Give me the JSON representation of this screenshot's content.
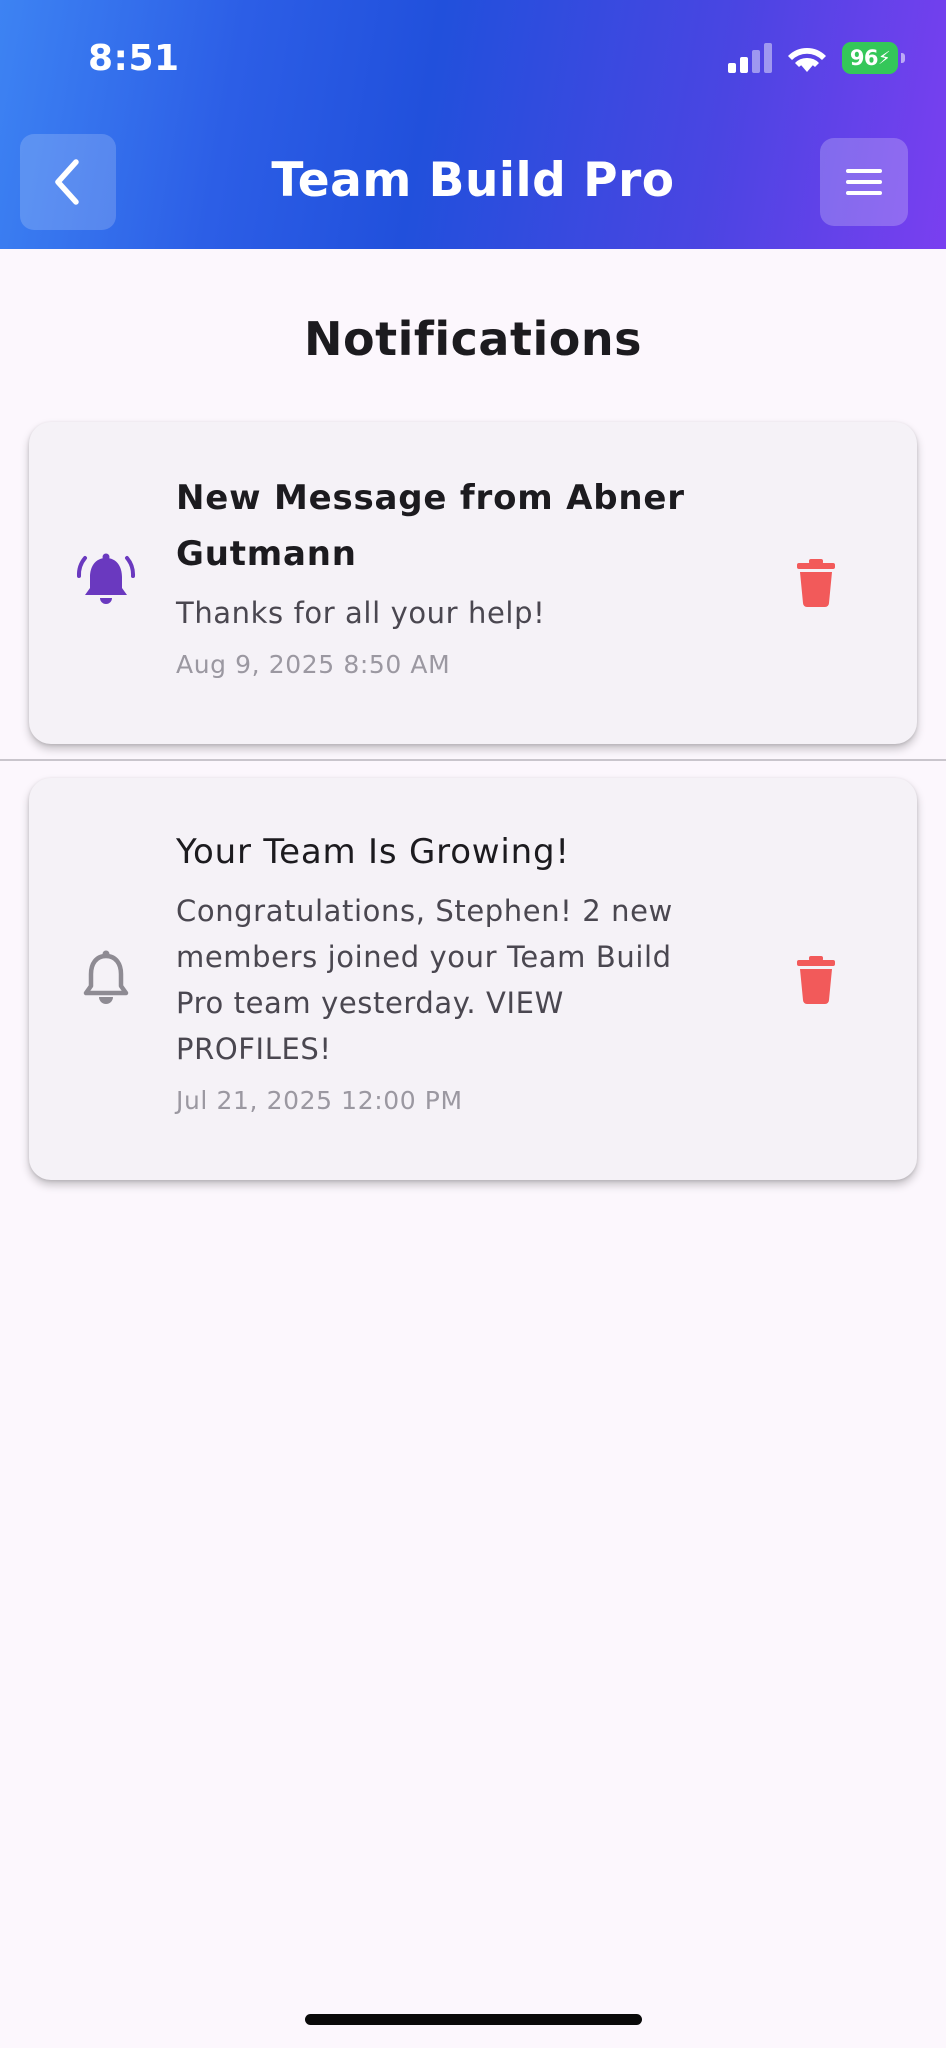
{
  "status_bar": {
    "time": "8:51",
    "battery": "96",
    "icons": [
      "cellular-signal-icon",
      "wifi-icon",
      "battery-charging-icon"
    ]
  },
  "header": {
    "title": "Team Build Pro",
    "back_icon": "chevron-left-icon",
    "menu_icon": "hamburger-menu-icon",
    "gradient_colors": [
      "#3d83f3",
      "#2150dc",
      "#7a3ff0"
    ]
  },
  "page": {
    "title": "Notifications"
  },
  "notifications": [
    {
      "title": "New Message from Abner Gutmann",
      "body": "Thanks for all your help!",
      "date": "Aug 9, 2025 8:50 AM",
      "read": false,
      "icon": "bell-ringing-icon",
      "icon_color": "#6a39bf",
      "delete_icon": "trash-icon"
    },
    {
      "title": "Your Team Is Growing!",
      "body": "Congratulations, Stephen! 2 new members joined your Team Build Pro team yesterday. VIEW PROFILES!",
      "date": "Jul 21, 2025 12:00 PM",
      "read": true,
      "icon": "bell-outline-icon",
      "icon_color": "#8e8b93",
      "delete_icon": "trash-icon"
    }
  ],
  "colors": {
    "delete": "#f25a5a",
    "background": "#fcf7fd",
    "card": "#f5f2f7"
  }
}
